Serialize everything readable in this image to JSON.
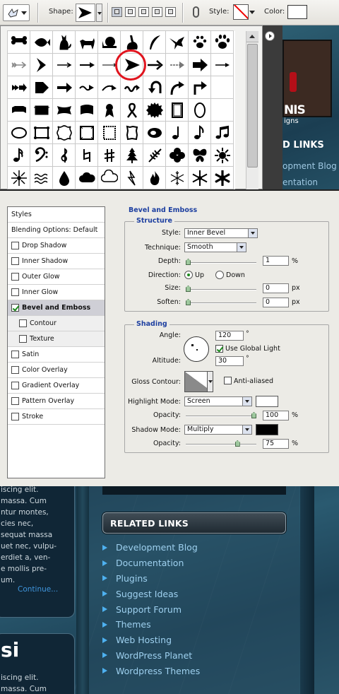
{
  "toolbar": {
    "shape_label": "Shape:",
    "style_label": "Style:",
    "color_label": "Color:",
    "color_value": "#ffffff"
  },
  "shape_picker": {
    "icons": [
      "bone-icon",
      "fish-icon",
      "cat-icon",
      "dog-icon",
      "snail-icon",
      "rabbit-icon",
      "feather-icon",
      "bird-icon",
      "paw-icon",
      "dog-paw-icon",
      "arrow-feathered-icon",
      "chevron-arrow-icon",
      "arrow-thin-icon",
      "arrow-long-icon",
      "arrow-line-icon",
      "arrow-triangle-icon",
      "arrow-simple-icon",
      "arrow-dash-icon",
      "arrow-fat-icon",
      "arrow-thin-right-icon",
      "arrow-double-icon",
      "pentagon-arrow-icon",
      "arrow-bold-icon",
      "arrow-wave-icon",
      "arrow-curved-icon",
      "arrow-squiggle-icon",
      "arrow-uturn-icon",
      "arrow-curve-up-icon",
      "arrow-turn-right-icon",
      "blank-icon",
      "banner-icon",
      "tag-icon",
      "bow-banner-icon",
      "scroll-banner-icon",
      "ribbon-badge-icon",
      "awareness-ribbon-icon",
      "seal-icon",
      "frame-rect-icon",
      "frame-oval-icon",
      "blank2-icon",
      "frame-ellipse-icon",
      "frame-fancy-icon",
      "frame-wavy-icon",
      "frame-square-icon",
      "stamp-icon",
      "frame-torn-icon",
      "eye-icon",
      "quarter-note-icon",
      "eighth-note-icon",
      "beamed-notes-icon",
      "sixteenth-note-icon",
      "bass-clef-icon",
      "treble-clef-icon",
      "natural-icon",
      "sharp-icon",
      "tree-icon",
      "fern-icon",
      "clover-icon",
      "butterfly-icon",
      "sun-icon",
      "sunburst-icon",
      "waves-icon",
      "drop-icon",
      "cloud-icon",
      "speech-cloud-icon",
      "lightning-icon",
      "flame-icon",
      "snowflake-outline-icon",
      "snowflake-icon",
      "snowflake-bold-icon"
    ]
  },
  "background_site_top": {
    "logo_partial": "NIS",
    "logo_sub": "igns",
    "header_partial": "D LINKS",
    "link1_partial": "opment Blog",
    "link2_partial": "entation"
  },
  "dialog": {
    "styles_header": "Styles",
    "blending_options": "Blending Options: Default",
    "styles": [
      {
        "label": "Drop Shadow",
        "checked": false
      },
      {
        "label": "Inner Shadow",
        "checked": false
      },
      {
        "label": "Outer Glow",
        "checked": false
      },
      {
        "label": "Inner Glow",
        "checked": false
      },
      {
        "label": "Bevel and Emboss",
        "checked": true
      },
      {
        "label": "Contour",
        "checked": false
      },
      {
        "label": "Texture",
        "checked": false
      },
      {
        "label": "Satin",
        "checked": false
      },
      {
        "label": "Color Overlay",
        "checked": false
      },
      {
        "label": "Gradient Overlay",
        "checked": false
      },
      {
        "label": "Pattern Overlay",
        "checked": false
      },
      {
        "label": "Stroke",
        "checked": false
      }
    ],
    "panel_title": "Bevel and Emboss",
    "structure": {
      "title": "Structure",
      "style_label": "Style:",
      "style_value": "Inner Bevel",
      "technique_label": "Technique:",
      "technique_value": "Smooth",
      "depth_label": "Depth:",
      "depth_value": "1",
      "depth_unit": "%",
      "direction_label": "Direction:",
      "direction_up": "Up",
      "direction_down": "Down",
      "size_label": "Size:",
      "size_value": "0",
      "size_unit": "px",
      "soften_label": "Soften:",
      "soften_value": "0",
      "soften_unit": "px"
    },
    "shading": {
      "title": "Shading",
      "angle_label": "Angle:",
      "angle_value": "120",
      "angle_unit": "°",
      "global_light_label": "Use Global Light",
      "global_light_checked": true,
      "altitude_label": "Altitude:",
      "altitude_value": "30",
      "altitude_unit": "°",
      "gloss_label": "Gloss Contour:",
      "anti_aliased_label": "Anti-aliased",
      "highlight_mode_label": "Highlight Mode:",
      "highlight_mode_value": "Screen",
      "highlight_color": "#ffffff",
      "highlight_opacity_label": "Opacity:",
      "highlight_opacity_value": "100",
      "highlight_opacity_unit": "%",
      "shadow_mode_label": "Shadow Mode:",
      "shadow_mode_value": "Multiply",
      "shadow_color": "#000000",
      "shadow_opacity_label": "Opacity:",
      "shadow_opacity_value": "75",
      "shadow_opacity_unit": "%"
    },
    "slider_levels": {
      "depth": 0.0,
      "size": 0.0,
      "soften": 0.0,
      "highlight_opacity": 1.0,
      "shadow_opacity": 0.75
    }
  },
  "site": {
    "post_lines": [
      "iscing elit.",
      "massa. Cum",
      "ntur montes,",
      "cies nec,",
      "sequat massa",
      "uet nec, vulpu-",
      "erdiet a, ven-",
      "e mollis pre-",
      "um."
    ],
    "continue_link": "Continue...",
    "post2_title": "si",
    "post2_line1": "iscing elit.",
    "post2_line2": "massa. Cum",
    "related_links_title": "RELATED LINKS",
    "links": [
      "Development Blog",
      "Documentation",
      "Plugins",
      "Suggest Ideas",
      "Support Forum",
      "Themes",
      "Web Hosting",
      "WordPress Planet",
      "Wordpress Themes"
    ]
  }
}
